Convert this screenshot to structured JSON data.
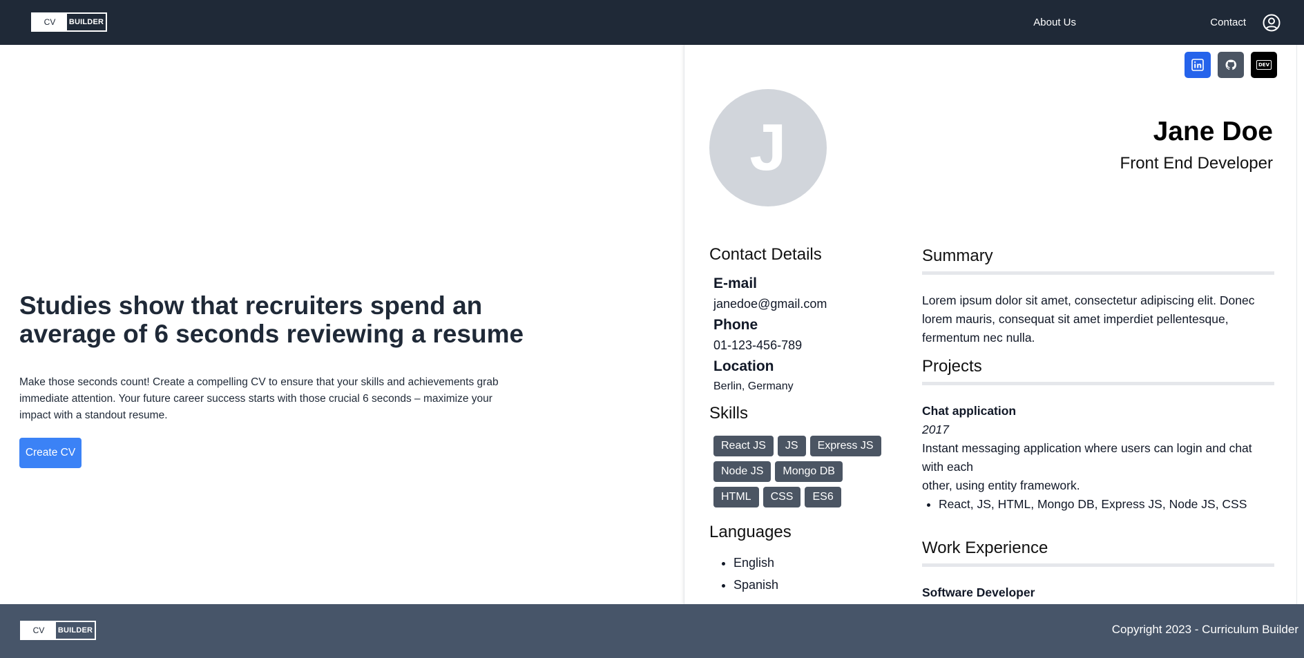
{
  "header": {
    "logo": {
      "left": "CV",
      "right": "BUILDER"
    },
    "nav": {
      "about": "About Us",
      "contact": "Contact"
    },
    "user_icon": "user-circle-icon"
  },
  "hero": {
    "title": "Studies show that recruiters spend an average of 6 seconds reviewing a resume",
    "text": "Make those seconds count! Create a compelling CV to ensure that your skills and achievements grab immediate attention. Your future career success starts with those crucial 6 seconds – maximize your impact with a standout resume.",
    "cta": "Create CV",
    "cta_color": "#3b82f6"
  },
  "cv": {
    "socials": [
      {
        "name": "linkedin-icon",
        "color": "#2563eb"
      },
      {
        "name": "github-icon",
        "color": "#4b5563"
      },
      {
        "name": "dev-icon",
        "label": "DEV",
        "color": "#000000"
      }
    ],
    "avatar_initial": "J",
    "name": "Jane Doe",
    "role": "Front End Developer",
    "contact": {
      "heading": "Contact Details",
      "email_label": "E-mail",
      "email": "janedoe@gmail.com",
      "phone_label": "Phone",
      "phone": "01-123-456-789",
      "location_label": "Location",
      "location": "Berlin, Germany"
    },
    "skills": {
      "heading": "Skills",
      "items": [
        "React JS",
        "JS",
        "Express JS",
        "Node JS",
        "Mongo DB",
        "HTML",
        "CSS",
        "ES6"
      ]
    },
    "languages": {
      "heading": "Languages",
      "items": [
        "English",
        "Spanish"
      ]
    },
    "summary": {
      "heading": "Summary",
      "text": "Lorem ipsum dolor sit amet, consectetur adipiscing elit. Donec lorem mauris, consequat sit amet imperdiet pellentesque, fermentum nec nulla."
    },
    "projects": {
      "heading": "Projects",
      "items": [
        {
          "name": "Chat application",
          "year": "2017",
          "desc_line1": "Instant messaging application where users can login and chat with each",
          "desc_line2": "other, using entity framework.",
          "tech": "React, JS, HTML, Mongo DB, Express JS, Node JS, CSS"
        }
      ]
    },
    "work": {
      "heading": "Work Experience",
      "items": [
        {
          "title": "Software Developer"
        }
      ]
    }
  },
  "footer": {
    "logo": {
      "left": "CV",
      "right": "BUILDER"
    },
    "copyright": "Copyright 2023 - Curriculum Builder"
  }
}
